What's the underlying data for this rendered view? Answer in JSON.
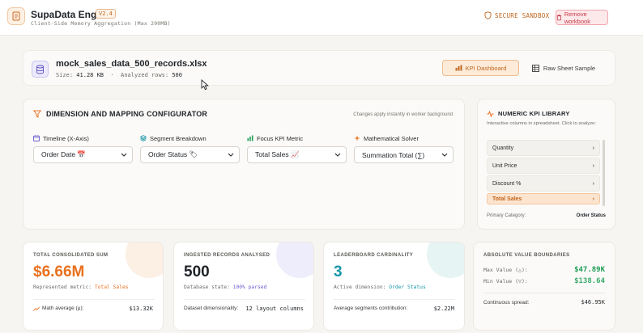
{
  "app": {
    "title": "SupaData Engine",
    "version": "V2.4",
    "subtitle": "Client-Side Memory Aggregation (Max 200MB)",
    "sandbox_label": "SECURE SANDBOX",
    "remove_label": "Remove workbook"
  },
  "file": {
    "name": "mock_sales_data_500_records.xlsx",
    "size_label": "Size:",
    "size": "41.28 KB",
    "separator": "·",
    "rows_label": "Analyzed rows:",
    "rows": "500",
    "tabs": [
      {
        "label": "KPI Dashboard",
        "active": true
      },
      {
        "label": "Raw Sheet Sample",
        "active": false
      }
    ]
  },
  "config": {
    "title": "DIMENSION AND MAPPING CONFIGURATOR",
    "note": "Changes apply instantly in worker background",
    "fields": [
      {
        "label": "Timeline (X-Axis)",
        "value": "Order Date 📅",
        "icon": "calendar-icon"
      },
      {
        "label": "Segment Breakdown",
        "value": "Order Status 🏷",
        "icon": "layers-icon"
      },
      {
        "label": "Focus KPI Metric",
        "value": "Total Sales 📈",
        "icon": "bar-chart-icon"
      },
      {
        "label": "Mathematical Solver",
        "value": "Summation Total (∑)",
        "icon": "sparkle-icon"
      }
    ]
  },
  "library": {
    "title": "NUMERIC KPI LIBRARY",
    "description": "Interactive columns in spreadsheet. Click to analyze:",
    "items": [
      {
        "label": "Quantity",
        "active": false
      },
      {
        "label": "Unit Price",
        "active": false
      },
      {
        "label": "Discount %",
        "active": false
      },
      {
        "label": "Total Sales",
        "active": true
      }
    ],
    "footer_label": "Primary Category:",
    "footer_value": "Order Status"
  },
  "cards": {
    "sum": {
      "label": "TOTAL CONSOLIDATED SUM",
      "value": "$6.66M",
      "sub_label": "Represented metric:",
      "sub_value": "Total Sales",
      "foot_label": "Math average (μ):",
      "foot_value": "$13.32K"
    },
    "records": {
      "label": "INGESTED RECORDS ANALYSED",
      "value": "500",
      "sub_label": "Database state:",
      "sub_value": "100% parsed",
      "foot_label": "Dataset dimensionality:",
      "foot_value": "12 layout columns"
    },
    "leaderboard": {
      "label": "LEADERBOARD CARDINALITY",
      "value": "3",
      "sub_label": "Active dimension:",
      "sub_value": "Order Status",
      "foot_label": "Average segments contribution:",
      "foot_value": "$2.22M"
    },
    "bounds": {
      "label": "ABSOLUTE VALUE BOUNDARIES",
      "max_label": "Max Value (△):",
      "max_value": "$47.89K",
      "min_label": "Min Value (▽):",
      "min_value": "$138.64",
      "spread_label": "Continuous spread:",
      "spread_value": "$46.95K"
    }
  },
  "colors": {
    "accent": "#e8711e",
    "purple": "#6a5acd",
    "teal": "#1797a8",
    "green": "#1f9d57",
    "danger": "#c53947"
  }
}
